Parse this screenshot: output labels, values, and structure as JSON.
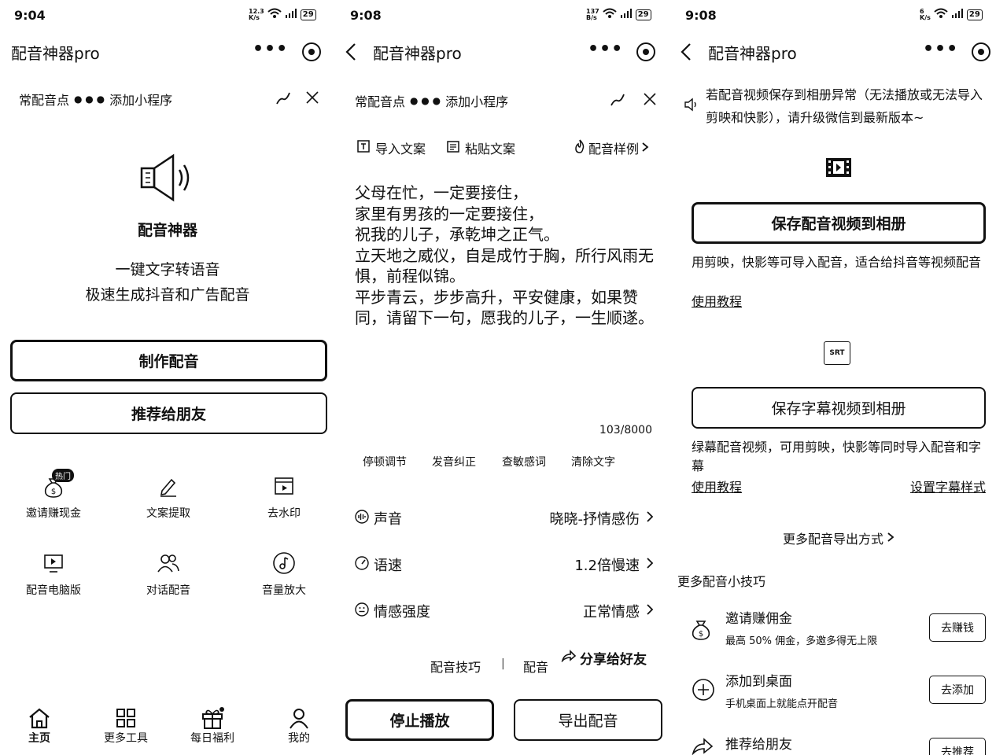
{
  "status": {
    "p1": {
      "time": "9:04",
      "speed": "12.3\nK/s",
      "battery": "29"
    },
    "p2": {
      "time": "9:08",
      "speed": "137\nB/s",
      "battery": "29"
    },
    "p3": {
      "time": "9:08",
      "speed": "6\nK/s",
      "battery": "29"
    }
  },
  "app_title": "配音神器pro",
  "mini_prompt": {
    "text1": "常配音点",
    "text2": "添加小程序"
  },
  "home": {
    "app_name": "配音神器",
    "slogan1": "一键文字转语音",
    "slogan2": "极速生成抖音和广告配音",
    "make_btn": "制作配音",
    "share_btn": "推荐给朋友",
    "hot_badge": "热门",
    "grid": [
      "邀请赚现金",
      "文案提取",
      "去水印",
      "配音电脑版",
      "对话配音",
      "音量放大"
    ],
    "tabbar": [
      "主页",
      "更多工具",
      "每日福利",
      "我的"
    ]
  },
  "editor": {
    "import_text": "导入文案",
    "paste_text": "粘贴文案",
    "samples": "配音样例",
    "body": "父母在忙，一定要接住，\n家里有男孩的一定要接住，\n祝我的儿子，承乾坤之正气。\n立天地之威仪，自是成竹于胸，所行风雨无惧，前程似锦。\n平步青云，步步高升，平安健康，如果赞同，请留下一句，愿我的儿子，一生顺遂。",
    "counter": "103/8000",
    "tools": [
      "停顿调节",
      "发音纠正",
      "查敏感词",
      "清除文字"
    ],
    "settings": [
      {
        "label": "声音",
        "value": "晓晓-抒情感伤"
      },
      {
        "label": "语速",
        "value": "1.2倍慢速"
      },
      {
        "label": "情感强度",
        "value": "正常情感"
      }
    ],
    "tips_link": "配音技巧",
    "sep": "|",
    "dub_link": "配音",
    "share_link": "分享给好友",
    "stop_btn": "停止播放",
    "export_btn": "导出配音"
  },
  "export": {
    "notice": "若配音视频保存到相册异常（无法播放或无法导入剪映和快影），请升级微信到最新版本~",
    "save_video_btn": "保存配音视频到相册",
    "save_video_desc": "用剪映，快影等可导入配音，适合给抖音等视频配音",
    "tutorial1": "使用教程",
    "srt_label": "SRT",
    "save_sub_btn": "保存字幕视频到相册",
    "save_sub_desc": "绿幕配音视频，可用剪映，快影等同时导入配音和字幕",
    "tutorial2": "使用教程",
    "sub_style": "设置字幕样式",
    "more_export": "更多配音导出方式",
    "more_tips": "更多配音小技巧",
    "tips": [
      {
        "title": "邀请赚佣金",
        "desc": "最高 50% 佣金，多邀多得无上限",
        "btn": "去赚钱"
      },
      {
        "title": "添加到桌面",
        "desc": "手机桌面上就能点开配音",
        "btn": "去添加"
      },
      {
        "title": "推荐给朋友",
        "desc": "",
        "btn": "去推荐"
      }
    ]
  }
}
